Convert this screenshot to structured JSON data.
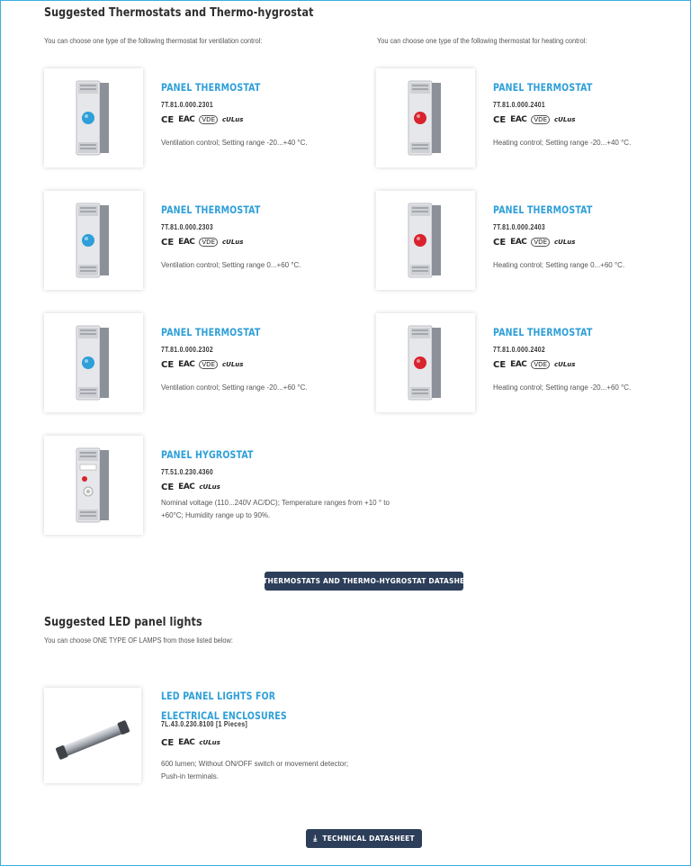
{
  "thermo_section": {
    "title": "Suggested Thermostats and Thermo-hygrostat",
    "ventilation_note": "You can choose one type of the following thermostat for ventilation control:",
    "heating_note": "You can choose one type of the following thermostat for heating control:"
  },
  "products": [
    {
      "title": "PANEL THERMOSTAT",
      "code": "7T.81.0.000.2301",
      "desc": "Ventilation control; Setting range -20...+40 °C.",
      "dial_color": "#2e9fd8"
    },
    {
      "title": "PANEL THERMOSTAT",
      "code": "7T.81.0.000.2401",
      "desc": "Heating control; Setting range -20...+40 °C.",
      "dial_color": "#d9232e"
    },
    {
      "title": "PANEL THERMOSTAT",
      "code": "7T.81.0.000.2303",
      "desc": "Ventilation control; Setting range 0...+60 °C.",
      "dial_color": "#2e9fd8"
    },
    {
      "title": "PANEL THERMOSTAT",
      "code": "7T.81.0.000.2403",
      "desc": "Heating control; Setting range 0...+60 °C.",
      "dial_color": "#d9232e"
    },
    {
      "title": "PANEL THERMOSTAT",
      "code": "7T.81.0.000.2302",
      "desc": "Ventilation control; Setting range -20...+60 °C.",
      "dial_color": "#2e9fd8"
    },
    {
      "title": "PANEL THERMOSTAT",
      "code": "7T.81.0.000.2402",
      "desc": "Heating control; Setting range -20...+60 °C.",
      "dial_color": "#d9232e"
    },
    {
      "title": "PANEL HYGROSTAT",
      "code": "7T.51.0.230.4360",
      "desc": "Nominal voltage (110...240V AC/DC); Temperature ranges from +10 ° to +60°C; Humidity range up to 90%.",
      "dial_color": "#d9232e"
    }
  ],
  "cert_marks": {
    "ce": "CE",
    "eac": "EAC",
    "vde": "VDE",
    "ul": "cULus"
  },
  "thermo_datasheet_button": "THERMOSTATS AND THERMO-HYGROSTAT DATASHEET",
  "led_section": {
    "title": "Suggested LED panel lights",
    "note": "You can choose ONE TYPE OF LAMPS from those listed below:",
    "product": {
      "title": "LED PANEL LIGHTS FOR ELECTRICAL ENCLOSURES",
      "code": "7L.43.0.230.8100 [1 Pieces]",
      "desc": "600 lumen; Without ON/OFF switch or movement detector; Push-in terminals."
    },
    "button": "TECHNICAL DATASHEET"
  },
  "icons": {
    "download": "download-icon"
  }
}
